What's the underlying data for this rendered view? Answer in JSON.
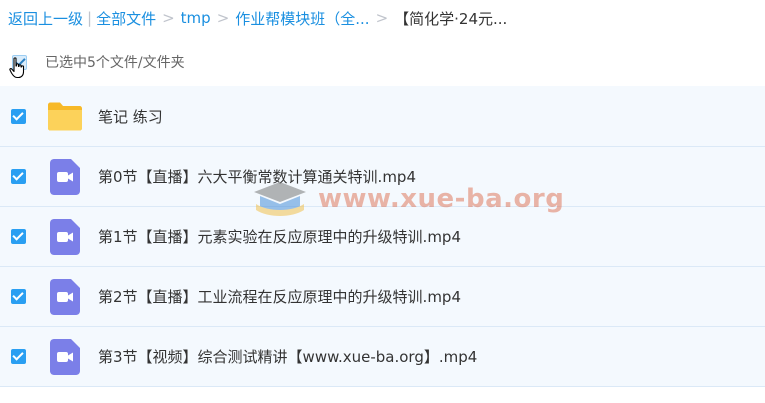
{
  "breadcrumb": {
    "back": "返回上一级",
    "all_files": "全部文件",
    "tmp": "tmp",
    "folder": "作业帮模块班（全...",
    "current": "【简化学·24元..."
  },
  "selection": {
    "label": "已选中5个文件/文件夹"
  },
  "files": [
    {
      "name": "笔记 练习",
      "type": "folder"
    },
    {
      "name": "第0节【直播】六大平衡常数计算通关特训.mp4",
      "type": "video"
    },
    {
      "name": "第1节【直播】元素实验在反应原理中的升级特训.mp4",
      "type": "video"
    },
    {
      "name": "第2节【直播】工业流程在反应原理中的升级特训.mp4",
      "type": "video"
    },
    {
      "name": "第3节【视频】综合测试精讲【www.xue-ba.org】.mp4",
      "type": "video"
    }
  ],
  "watermark": {
    "text": "www.xue-ba.org"
  },
  "colors": {
    "link": "#1a8fe0",
    "checkbox": "#2a9ff2",
    "row_bg": "#f4f9fe",
    "folder": "#fbc94a",
    "video_icon": "#7b7fe8"
  },
  "icons": {
    "folder": "folder-icon",
    "video": "video-file-icon",
    "cursor": "hand-pointer-icon"
  }
}
